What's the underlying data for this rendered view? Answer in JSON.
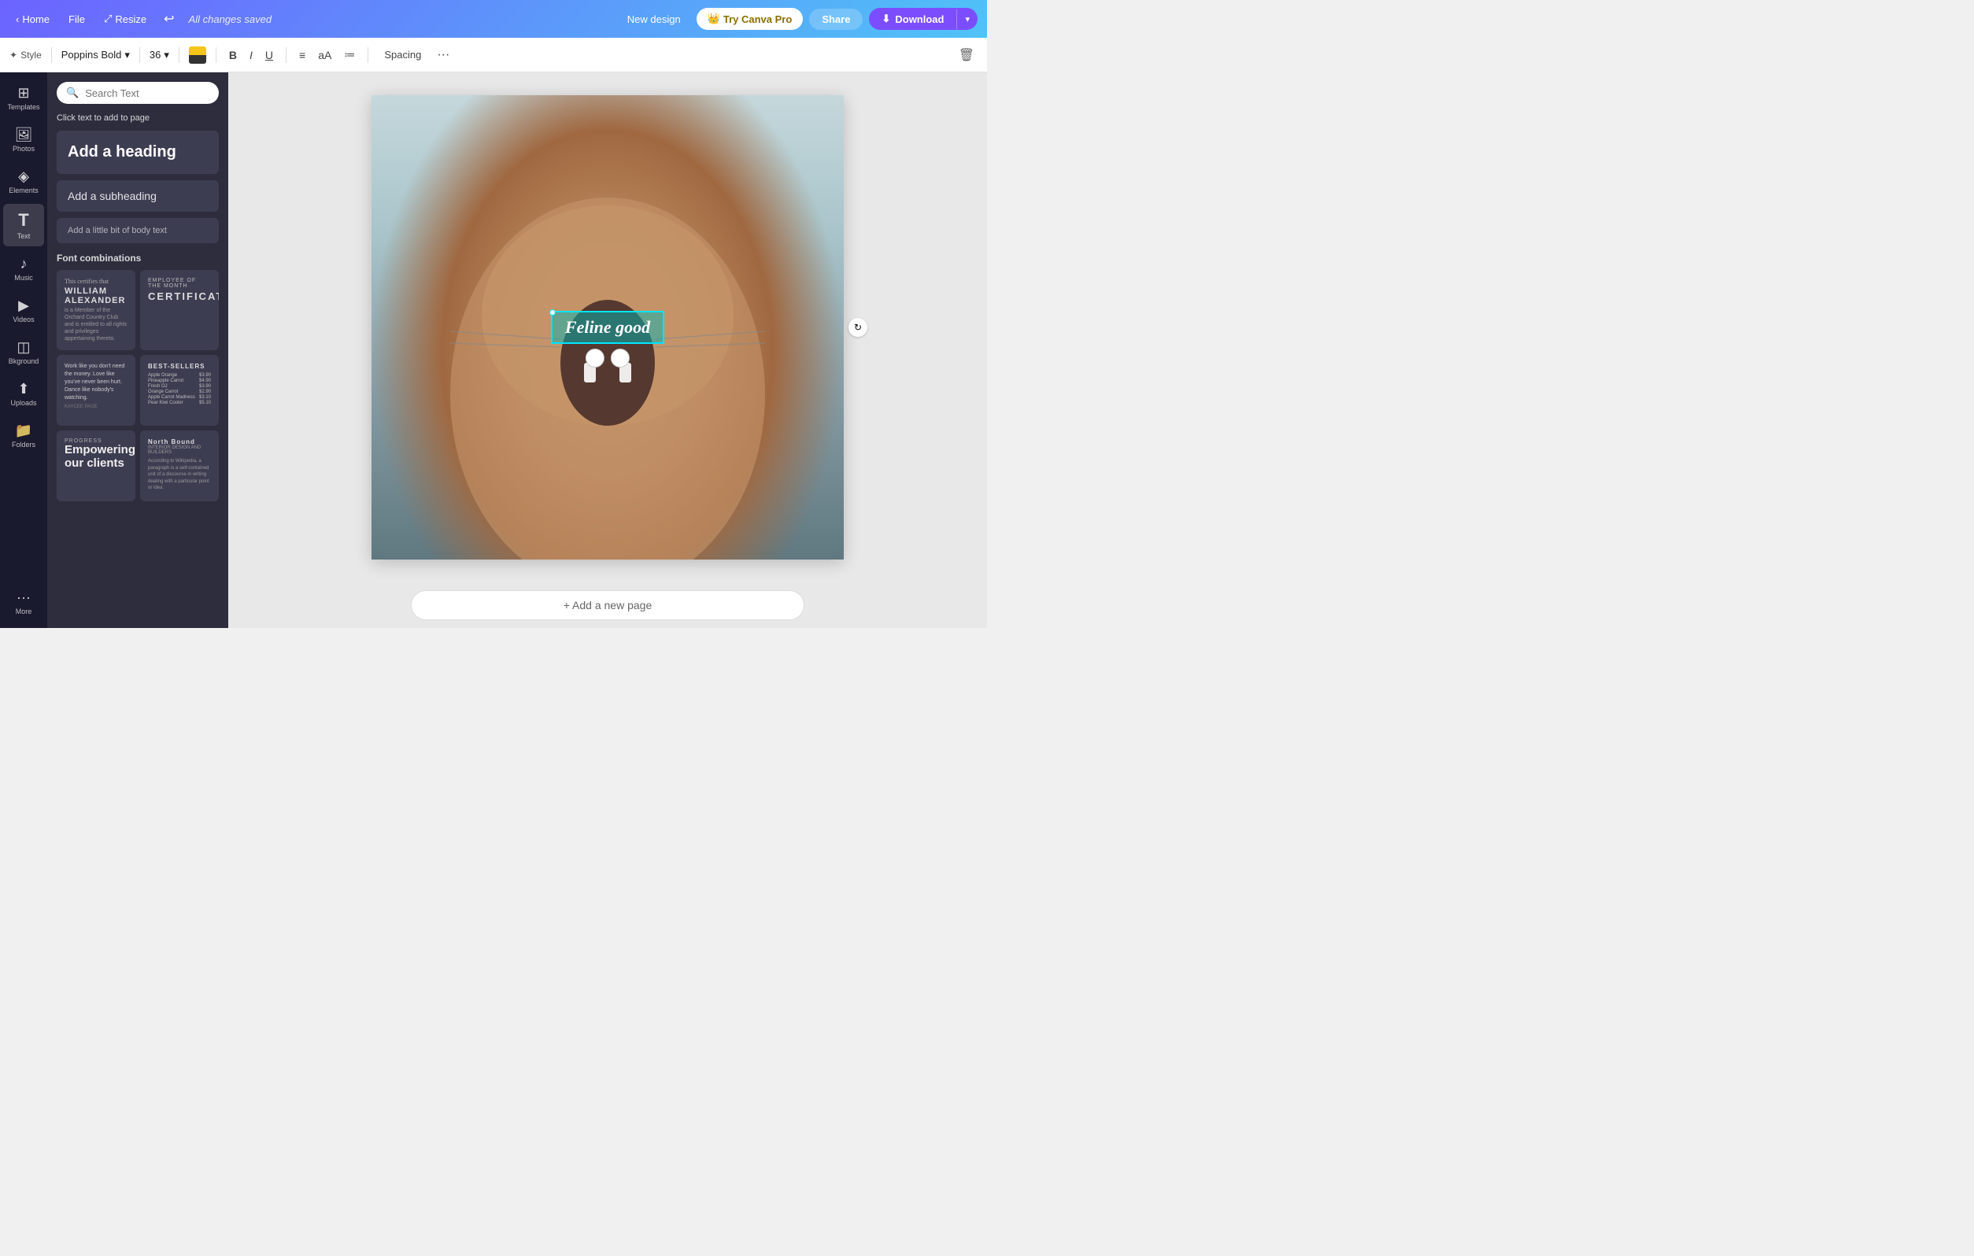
{
  "header": {
    "home_label": "Home",
    "file_label": "File",
    "resize_label": "Resize",
    "saved_label": "All changes saved",
    "new_design_label": "New design",
    "try_pro_label": "Try Canva Pro",
    "share_label": "Share",
    "download_label": "Download"
  },
  "toolbar": {
    "style_label": "Style",
    "font_label": "Poppins Bold",
    "font_size": "36",
    "bold_label": "B",
    "italic_label": "I",
    "underline_label": "U",
    "align_label": "≡",
    "case_label": "aA",
    "list_label": "≔",
    "spacing_label": "Spacing",
    "more_label": "···",
    "delete_label": "🗑"
  },
  "sidebar": {
    "items": [
      {
        "id": "templates",
        "label": "Templates",
        "icon": "⊞"
      },
      {
        "id": "photos",
        "label": "Photos",
        "icon": "🖼"
      },
      {
        "id": "elements",
        "label": "Elements",
        "icon": "◈"
      },
      {
        "id": "text",
        "label": "Text",
        "icon": "T"
      },
      {
        "id": "music",
        "label": "Music",
        "icon": "♪"
      },
      {
        "id": "videos",
        "label": "Videos",
        "icon": "▶"
      },
      {
        "id": "background",
        "label": "Bkground",
        "icon": "◫"
      },
      {
        "id": "uploads",
        "label": "Uploads",
        "icon": "↑"
      },
      {
        "id": "folders",
        "label": "Folders",
        "icon": "📁"
      },
      {
        "id": "more",
        "label": "More",
        "icon": "···"
      }
    ]
  },
  "text_panel": {
    "search_placeholder": "Search Text",
    "click_to_add": "Click text to add to page",
    "add_heading": "Add a heading",
    "add_subheading": "Add a subheading",
    "add_body": "Add a little bit of body text",
    "font_combos_label": "Font combinations",
    "font_cards": [
      {
        "id": "card1",
        "sub": "This certifies that",
        "title": "WILLIAM ALEXANDER",
        "body": "is a Member of the Orchard Country Club and is entitled to all rights and privileges appertaining thereto."
      },
      {
        "id": "card2",
        "sub": "EMPLOYEE OF THE MONTH",
        "title": "CERTIFICATE"
      },
      {
        "id": "card3",
        "body": "Work like you don't need the money. Love like you've never been hurt. Dance like nobody's watching.",
        "credit": "KAYCEE PAGE"
      },
      {
        "id": "card4",
        "title": "BEST-SELLERS",
        "items": [
          {
            "name": "Apple Orange",
            "price": "$3.90"
          },
          {
            "name": "Pineapple Carrot",
            "price": "$4.90"
          },
          {
            "name": "Fresh OJ",
            "price": "$3.90"
          },
          {
            "name": "Orange Carrot",
            "price": "$2.90"
          },
          {
            "name": "Apple Carrot Madness",
            "price": "$3.10"
          },
          {
            "name": "Pear Kiwi Cooler",
            "price": "$5.10"
          }
        ]
      },
      {
        "id": "card5",
        "sub": "PROGRESS",
        "title": "Empowering our clients"
      },
      {
        "id": "card6",
        "title": "North Bound",
        "sub": "INTERIOR DESIGN AND BUILDERS",
        "body": "According to Wikipedia, a paragraph is a self-contained unit of a discourse in writing dealing with a particular point or idea."
      }
    ]
  },
  "canvas": {
    "text_content": "Feline good",
    "add_page_label": "+ Add a new page"
  }
}
